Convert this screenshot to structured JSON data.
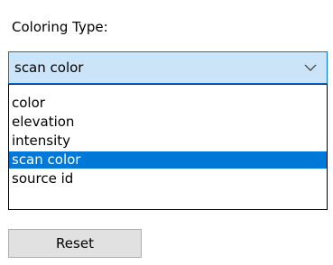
{
  "coloring": {
    "label": "Coloring Type:",
    "selected_value": "scan color",
    "chevron_icon": "chevron-down-icon",
    "options": [
      {
        "label": "color",
        "selected": false
      },
      {
        "label": "elevation",
        "selected": false
      },
      {
        "label": "intensity",
        "selected": false
      },
      {
        "label": "scan color",
        "selected": true
      },
      {
        "label": "source id",
        "selected": false
      }
    ]
  },
  "actions": {
    "reset_label": "Reset"
  },
  "colors": {
    "select_background": "#cce4f7",
    "select_border": "#0078d7",
    "highlight": "#0078d7",
    "button_background": "#e1e1e1"
  }
}
